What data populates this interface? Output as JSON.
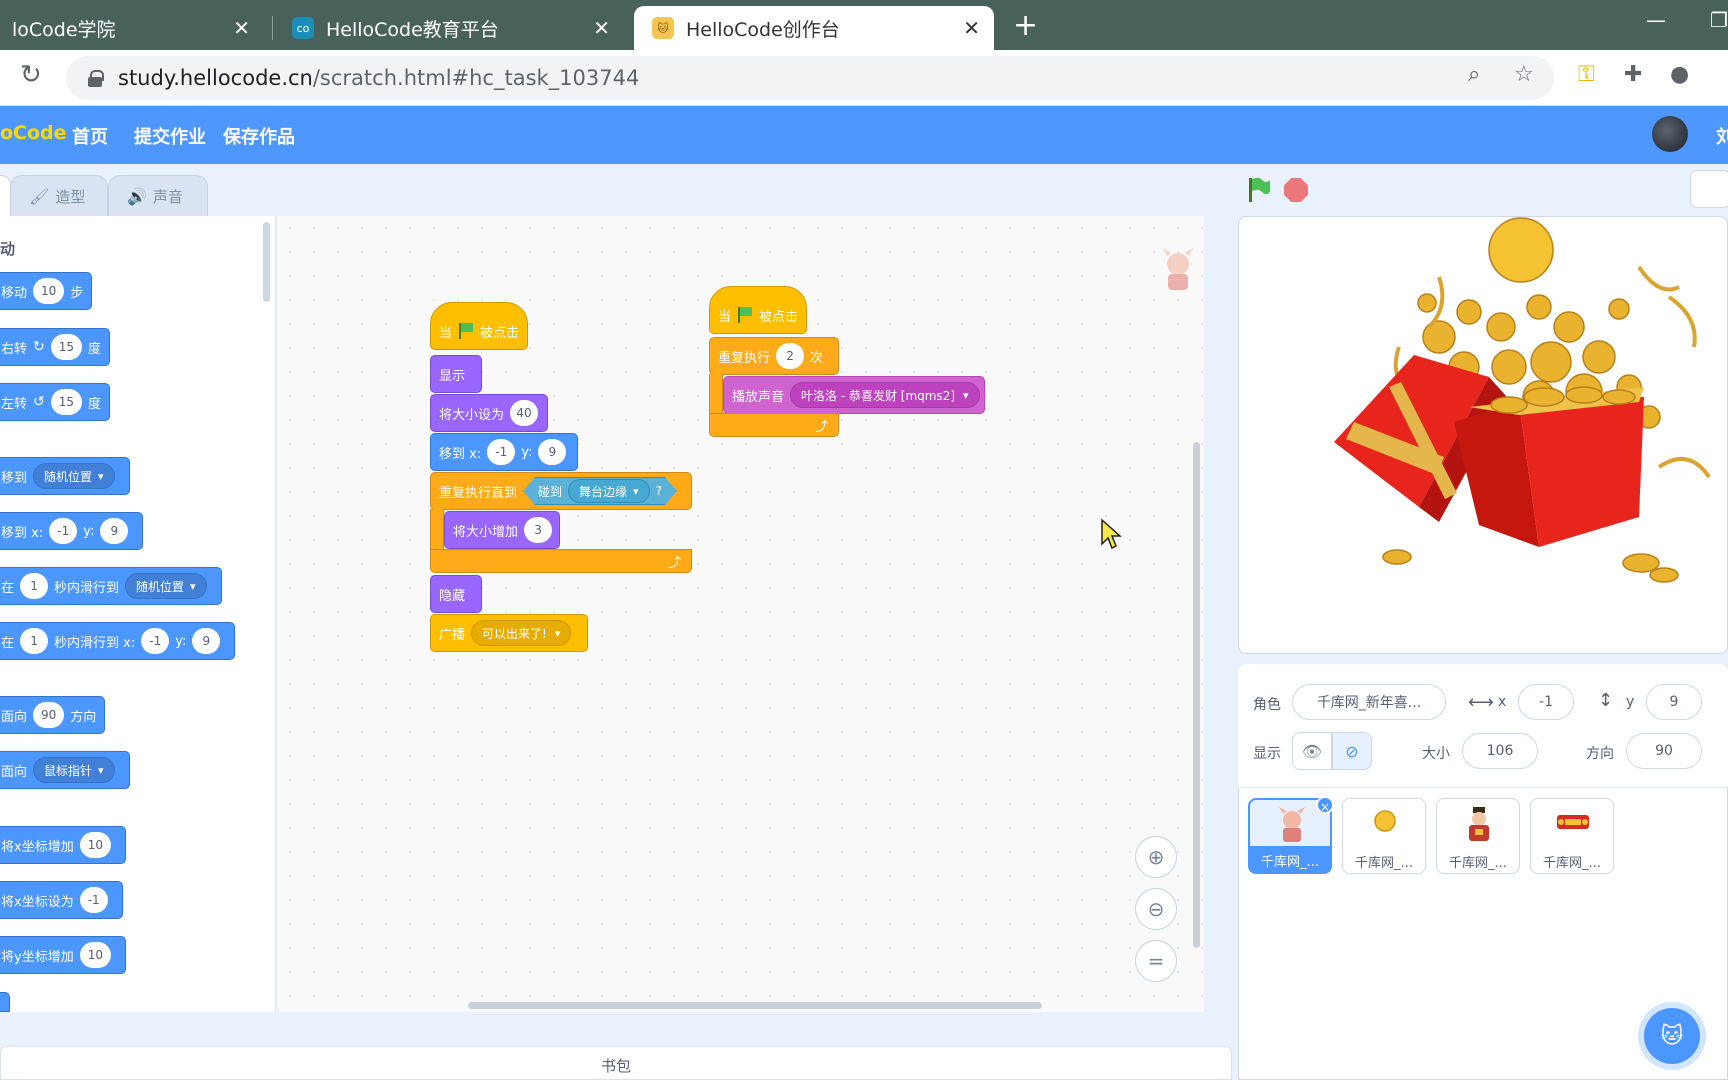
{
  "browser": {
    "tabs": [
      {
        "title": "loCode学院"
      },
      {
        "title": "HelloCode教育平台"
      },
      {
        "title": "HelloCode创作台"
      }
    ],
    "url_host": "study.hellocode.cn",
    "url_path": "/scratch.html#hc_task_103744"
  },
  "header": {
    "brand": "oCode",
    "nav": [
      "首页",
      "提交作业",
      "保存作品"
    ],
    "user": "刘"
  },
  "editor_tabs": [
    "造型",
    "声音"
  ],
  "palette": {
    "category": "动",
    "blocks": [
      {
        "t1": "移动",
        "v1": "10",
        "t2": "步"
      },
      {
        "t1": "右转",
        "v1": "15",
        "t2": "度"
      },
      {
        "t1": "左转",
        "v1": "15",
        "t2": "度"
      },
      {
        "t1": "移到",
        "d1": "随机位置"
      },
      {
        "t1": "移到 x:",
        "v1": "-1",
        "t2": "y:",
        "v2": "9"
      },
      {
        "t1": "在",
        "v1": "1",
        "t2": "秒内滑行到",
        "d1": "随机位置"
      },
      {
        "t1": "在",
        "v1": "1",
        "t2": "秒内滑行到 x:",
        "v2": "-1",
        "t3": "y:",
        "v3": "9"
      },
      {
        "t1": "面向",
        "v1": "90",
        "t2": "方向"
      },
      {
        "t1": "面向",
        "d1": "鼠标指针"
      },
      {
        "t1": "将x坐标增加",
        "v1": "10"
      },
      {
        "t1": "将x坐标设为",
        "v1": "-1"
      },
      {
        "t1": "将y坐标增加",
        "v1": "10"
      }
    ]
  },
  "script1": {
    "hat_when": "当",
    "hat_clicked": "被点击",
    "show": "显示",
    "set_size": "将大小设为",
    "set_size_val": "40",
    "goto": "移到 x:",
    "goto_x": "-1",
    "goto_y_label": "y:",
    "goto_y": "9",
    "repeat_until": "重复执行直到",
    "touching": "碰到",
    "touching_target": "舞台边缘",
    "q": "?",
    "change_size": "将大小增加",
    "change_size_val": "3",
    "hide": "隐藏",
    "broadcast": "广播",
    "broadcast_msg": "可以出来了!"
  },
  "script2": {
    "hat_when": "当",
    "hat_clicked": "被点击",
    "repeat": "重复执行",
    "repeat_val": "2",
    "repeat_unit": "次",
    "play_sound": "播放声音",
    "sound_name": "叶洛洛 - 恭喜发财 [mqms2]"
  },
  "sprite": {
    "label": "角色",
    "name": "千库网_新年喜...",
    "x_label": "x",
    "x": "-1",
    "y_label": "y",
    "y": "9",
    "show_label": "显示",
    "size_label": "大小",
    "size": "106",
    "dir_label": "方向",
    "dir": "90"
  },
  "sprites": [
    "千库网_...",
    "千库网_...",
    "千库网_...",
    "千库网_..."
  ],
  "backpack": "书包",
  "colors": {
    "motion": "#4c97ff",
    "looks": "#9966ff",
    "control": "#ffab19",
    "events": "#ffbf00",
    "sound": "#cf63cf",
    "sensing": "#5cb1d6",
    "header": "#4d97ff"
  }
}
